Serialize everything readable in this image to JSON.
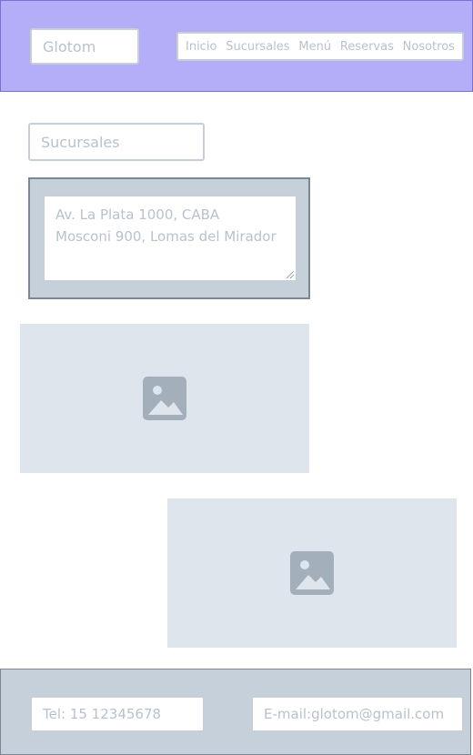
{
  "header": {
    "brand": "Glotom",
    "nav": [
      "Inicio",
      "Sucursales",
      "Menú",
      "Reservas",
      "Nosotros"
    ]
  },
  "main": {
    "section_title": "Sucursales",
    "addresses": [
      "Av. La Plata 1000, CABA",
      "Mosconi 900, Lomas del Mirador"
    ]
  },
  "footer": {
    "phone": "Tel: 15 12345678",
    "email": "E-mail:glotom@gmail.com"
  },
  "colors": {
    "header_bg": "#b3aef7",
    "panel_bg": "#c6d0da",
    "placeholder_bg": "#dfe5ed"
  },
  "icons": [
    "image-icon"
  ]
}
